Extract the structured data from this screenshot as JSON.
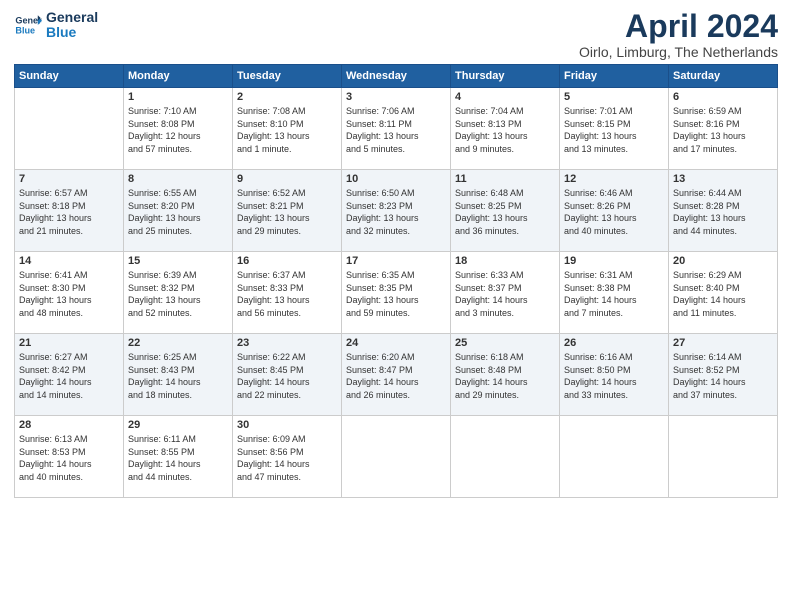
{
  "header": {
    "logo_line1": "General",
    "logo_line2": "Blue",
    "month": "April 2024",
    "location": "Oirlo, Limburg, The Netherlands"
  },
  "weekdays": [
    "Sunday",
    "Monday",
    "Tuesday",
    "Wednesday",
    "Thursday",
    "Friday",
    "Saturday"
  ],
  "weeks": [
    [
      {
        "day": "",
        "info": ""
      },
      {
        "day": "1",
        "info": "Sunrise: 7:10 AM\nSunset: 8:08 PM\nDaylight: 12 hours\nand 57 minutes."
      },
      {
        "day": "2",
        "info": "Sunrise: 7:08 AM\nSunset: 8:10 PM\nDaylight: 13 hours\nand 1 minute."
      },
      {
        "day": "3",
        "info": "Sunrise: 7:06 AM\nSunset: 8:11 PM\nDaylight: 13 hours\nand 5 minutes."
      },
      {
        "day": "4",
        "info": "Sunrise: 7:04 AM\nSunset: 8:13 PM\nDaylight: 13 hours\nand 9 minutes."
      },
      {
        "day": "5",
        "info": "Sunrise: 7:01 AM\nSunset: 8:15 PM\nDaylight: 13 hours\nand 13 minutes."
      },
      {
        "day": "6",
        "info": "Sunrise: 6:59 AM\nSunset: 8:16 PM\nDaylight: 13 hours\nand 17 minutes."
      }
    ],
    [
      {
        "day": "7",
        "info": "Sunrise: 6:57 AM\nSunset: 8:18 PM\nDaylight: 13 hours\nand 21 minutes."
      },
      {
        "day": "8",
        "info": "Sunrise: 6:55 AM\nSunset: 8:20 PM\nDaylight: 13 hours\nand 25 minutes."
      },
      {
        "day": "9",
        "info": "Sunrise: 6:52 AM\nSunset: 8:21 PM\nDaylight: 13 hours\nand 29 minutes."
      },
      {
        "day": "10",
        "info": "Sunrise: 6:50 AM\nSunset: 8:23 PM\nDaylight: 13 hours\nand 32 minutes."
      },
      {
        "day": "11",
        "info": "Sunrise: 6:48 AM\nSunset: 8:25 PM\nDaylight: 13 hours\nand 36 minutes."
      },
      {
        "day": "12",
        "info": "Sunrise: 6:46 AM\nSunset: 8:26 PM\nDaylight: 13 hours\nand 40 minutes."
      },
      {
        "day": "13",
        "info": "Sunrise: 6:44 AM\nSunset: 8:28 PM\nDaylight: 13 hours\nand 44 minutes."
      }
    ],
    [
      {
        "day": "14",
        "info": "Sunrise: 6:41 AM\nSunset: 8:30 PM\nDaylight: 13 hours\nand 48 minutes."
      },
      {
        "day": "15",
        "info": "Sunrise: 6:39 AM\nSunset: 8:32 PM\nDaylight: 13 hours\nand 52 minutes."
      },
      {
        "day": "16",
        "info": "Sunrise: 6:37 AM\nSunset: 8:33 PM\nDaylight: 13 hours\nand 56 minutes."
      },
      {
        "day": "17",
        "info": "Sunrise: 6:35 AM\nSunset: 8:35 PM\nDaylight: 13 hours\nand 59 minutes."
      },
      {
        "day": "18",
        "info": "Sunrise: 6:33 AM\nSunset: 8:37 PM\nDaylight: 14 hours\nand 3 minutes."
      },
      {
        "day": "19",
        "info": "Sunrise: 6:31 AM\nSunset: 8:38 PM\nDaylight: 14 hours\nand 7 minutes."
      },
      {
        "day": "20",
        "info": "Sunrise: 6:29 AM\nSunset: 8:40 PM\nDaylight: 14 hours\nand 11 minutes."
      }
    ],
    [
      {
        "day": "21",
        "info": "Sunrise: 6:27 AM\nSunset: 8:42 PM\nDaylight: 14 hours\nand 14 minutes."
      },
      {
        "day": "22",
        "info": "Sunrise: 6:25 AM\nSunset: 8:43 PM\nDaylight: 14 hours\nand 18 minutes."
      },
      {
        "day": "23",
        "info": "Sunrise: 6:22 AM\nSunset: 8:45 PM\nDaylight: 14 hours\nand 22 minutes."
      },
      {
        "day": "24",
        "info": "Sunrise: 6:20 AM\nSunset: 8:47 PM\nDaylight: 14 hours\nand 26 minutes."
      },
      {
        "day": "25",
        "info": "Sunrise: 6:18 AM\nSunset: 8:48 PM\nDaylight: 14 hours\nand 29 minutes."
      },
      {
        "day": "26",
        "info": "Sunrise: 6:16 AM\nSunset: 8:50 PM\nDaylight: 14 hours\nand 33 minutes."
      },
      {
        "day": "27",
        "info": "Sunrise: 6:14 AM\nSunset: 8:52 PM\nDaylight: 14 hours\nand 37 minutes."
      }
    ],
    [
      {
        "day": "28",
        "info": "Sunrise: 6:13 AM\nSunset: 8:53 PM\nDaylight: 14 hours\nand 40 minutes."
      },
      {
        "day": "29",
        "info": "Sunrise: 6:11 AM\nSunset: 8:55 PM\nDaylight: 14 hours\nand 44 minutes."
      },
      {
        "day": "30",
        "info": "Sunrise: 6:09 AM\nSunset: 8:56 PM\nDaylight: 14 hours\nand 47 minutes."
      },
      {
        "day": "",
        "info": ""
      },
      {
        "day": "",
        "info": ""
      },
      {
        "day": "",
        "info": ""
      },
      {
        "day": "",
        "info": ""
      }
    ]
  ]
}
